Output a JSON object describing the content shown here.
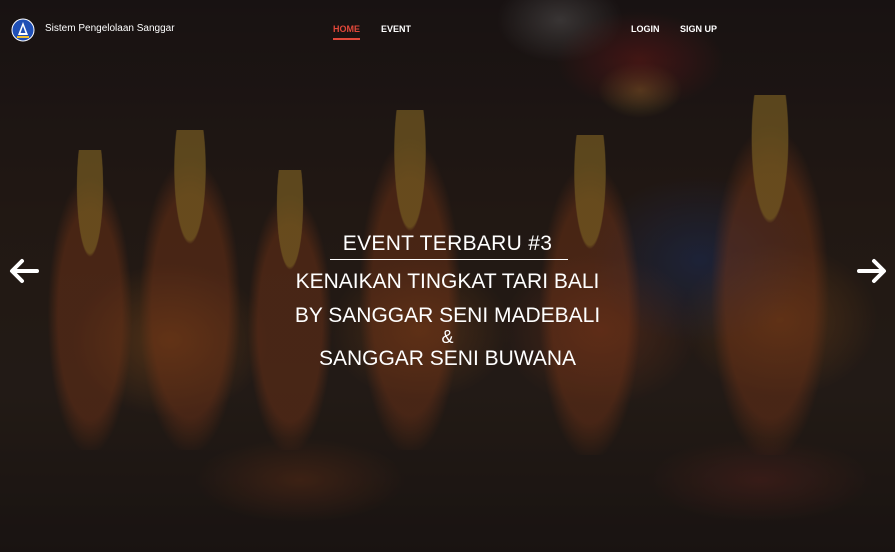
{
  "brand": {
    "name": "Sistem Pengelolaan Sanggar",
    "logo_icon": "crest-logo-icon"
  },
  "nav": {
    "home_label": "HOME",
    "event_label": "EVENT",
    "login_label": "LOGIN",
    "signup_label": "SIGN UP",
    "active_color": "#e0483a"
  },
  "carousel": {
    "prev_icon": "arrow-left-icon",
    "next_icon": "arrow-right-icon",
    "slide": {
      "event_label": "EVENT TERBARU #3",
      "title": "KENAIKAN TINGKAT TARI BALI",
      "by_line": "BY SANGGAR SENI MADEBALI",
      "ampersand": "&",
      "second_organizer": "SANGGAR SENI BUWANA"
    }
  }
}
